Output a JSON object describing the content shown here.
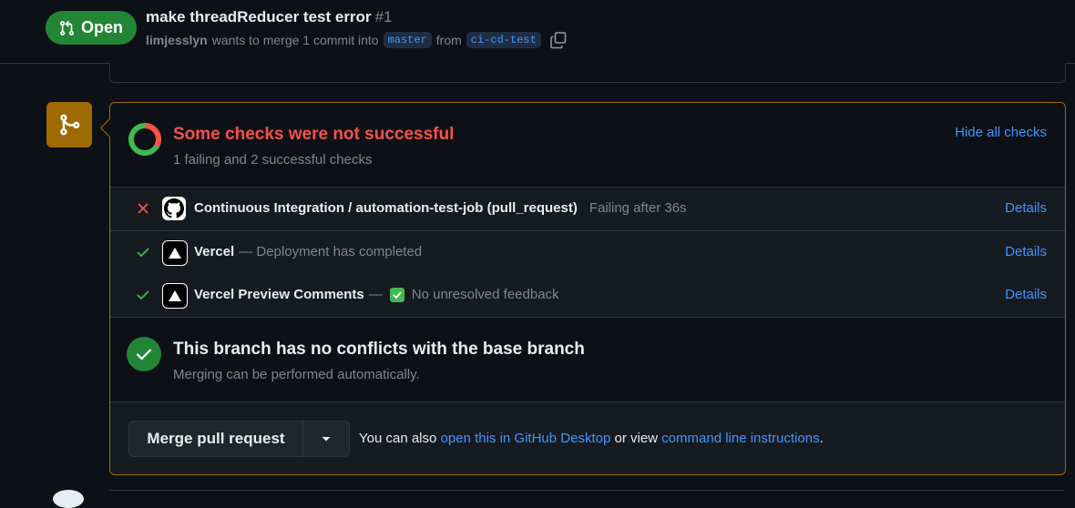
{
  "header": {
    "state_label": "Open",
    "title": "make threadReducer test error",
    "number": "#1",
    "author": "limjesslyn",
    "merge_text": "wants to merge 1 commit into",
    "base_branch": "master",
    "from_text": "from",
    "head_branch": "ci-cd-test"
  },
  "checks": {
    "title": "Some checks were not successful",
    "summary": "1 failing and 2 successful checks",
    "hide_label": "Hide all checks",
    "items": [
      {
        "status": "failing",
        "name": "Continuous Integration / automation-test-job (pull_request)",
        "description": "Failing after 36s",
        "details_label": "Details",
        "icon": "github-icon"
      },
      {
        "status": "success",
        "name": "Vercel",
        "description": "— Deployment has completed",
        "details_label": "Details",
        "icon": "vercel-icon"
      },
      {
        "status": "success",
        "name": "Vercel Preview Comments",
        "description_prefix": "—",
        "description": "No unresolved feedback",
        "details_label": "Details",
        "icon": "vercel-icon"
      }
    ]
  },
  "conflicts": {
    "title": "This branch has no conflicts with the base branch",
    "subtitle": "Merging can be performed automatically."
  },
  "merge": {
    "button_label": "Merge pull request",
    "note_prefix": "You can also",
    "desktop_link": "open this in GitHub Desktop",
    "note_middle": "or view",
    "cli_link": "command line instructions",
    "note_suffix": "."
  },
  "colors": {
    "open_green": "#238636",
    "fail_red": "#f85149",
    "success_green": "#3fb950",
    "link_blue": "#4493f8",
    "warning_border": "#9e6a03"
  }
}
